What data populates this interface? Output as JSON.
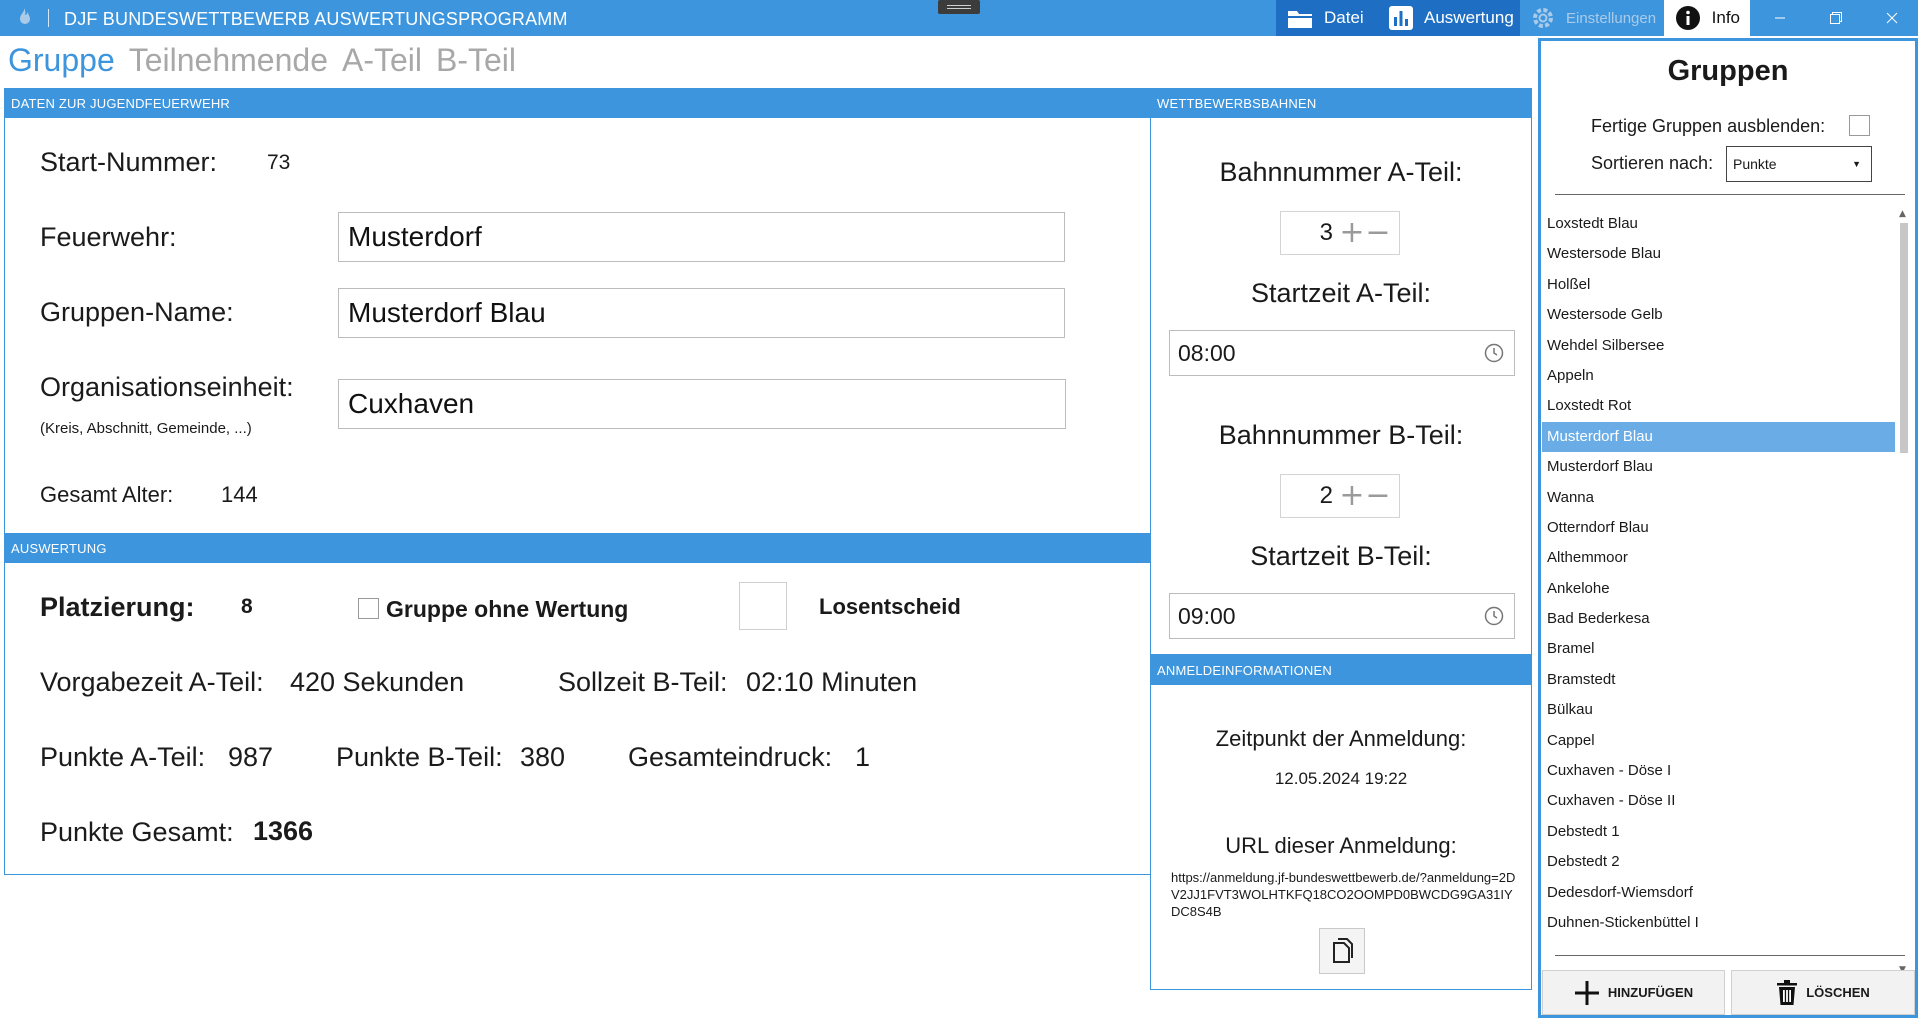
{
  "app": {
    "title": "DJF BUNDESWETTBEWERB AUSWERTUNGSPROGRAMM"
  },
  "menu": {
    "datei": "Datei",
    "auswertung": "Auswertung",
    "einstellungen": "Einstellungen",
    "info": "Info"
  },
  "tabs": [
    "Gruppe",
    "Teilnehmende",
    "A-Teil",
    "B-Teil"
  ],
  "data_section": {
    "header": "DATEN ZUR JUGENDFEUERWEHR",
    "start_label": "Start-Nummer:",
    "start_value": "73",
    "feuerwehr_label": "Feuerwehr:",
    "feuerwehr_value": "Musterdorf",
    "gruppenname_label": "Gruppen-Name:",
    "gruppenname_value": "Musterdorf Blau",
    "orga_label": "Organisationseinheit:",
    "orga_hint": "(Kreis, Abschnitt, Gemeinde, ...)",
    "orga_value": "Cuxhaven",
    "alter_label": "Gesamt Alter:",
    "alter_value": "144"
  },
  "eval_section": {
    "header": "AUSWERTUNG",
    "platz_label": "Platzierung:",
    "platz_value": "8",
    "ohne_wertung_label": "Gruppe ohne Wertung",
    "losentscheid_label": "Losentscheid",
    "vorgabe_label": "Vorgabezeit A-Teil:",
    "vorgabe_value": "420 Sekunden",
    "sollzeit_label": "Sollzeit B-Teil:",
    "sollzeit_value": "02:10 Minuten",
    "pa_label": "Punkte A-Teil:",
    "pa_value": "987",
    "pb_label": "Punkte B-Teil:",
    "pb_value": "380",
    "ge_label": "Gesamteindruck:",
    "ge_value": "1",
    "pg_label": "Punkte Gesamt:",
    "pg_value": "1366"
  },
  "bahnen": {
    "header": "WETTBEWERBSBAHNEN",
    "a_bahn_label": "Bahnnummer A-Teil:",
    "a_bahn_value": "3",
    "a_start_label": "Startzeit A-Teil:",
    "a_start_value": "08:00",
    "b_bahn_label": "Bahnnummer B-Teil:",
    "b_bahn_value": "2",
    "b_start_label": "Startzeit B-Teil:",
    "b_start_value": "09:00"
  },
  "anmeldung": {
    "header": "ANMELDEINFORMATIONEN",
    "zeit_label": "Zeitpunkt der Anmeldung:",
    "zeit_value": "12.05.2024 19:22",
    "url_label": "URL dieser Anmeldung:",
    "url_value": "https://anmeldung.jf-bundeswettbewerb.de/?anmeldung=2DV2JJ1FVT3WOLHTKFQ18CO2OOMPD0BWCDG9GA31IYDC8S4B"
  },
  "groups": {
    "title": "Gruppen",
    "hide_label": "Fertige Gruppen ausblenden:",
    "sort_label": "Sortieren nach:",
    "sort_value": "Punkte",
    "items": [
      "Loxstedt Blau",
      "Westersode Blau",
      "Holßel",
      "Westersode Gelb",
      "Wehdel Silbersee",
      "Appeln",
      "Loxstedt Rot",
      "Musterdorf Blau",
      "Musterdorf Blau",
      "Wanna",
      "Otterndorf Blau",
      "Althemmoor",
      "Ankelohe",
      "Bad Bederkesa",
      "Bramel",
      "Bramstedt",
      "Bülkau",
      "Cappel",
      "Cuxhaven - Döse I",
      "Cuxhaven - Döse II",
      "Debstedt 1",
      "Debstedt 2",
      "Dedesdorf-Wiemsdorf",
      "Duhnen-Stickenbüttel I"
    ],
    "add_label": "HINZUFÜGEN",
    "delete_label": "LÖSCHEN"
  }
}
